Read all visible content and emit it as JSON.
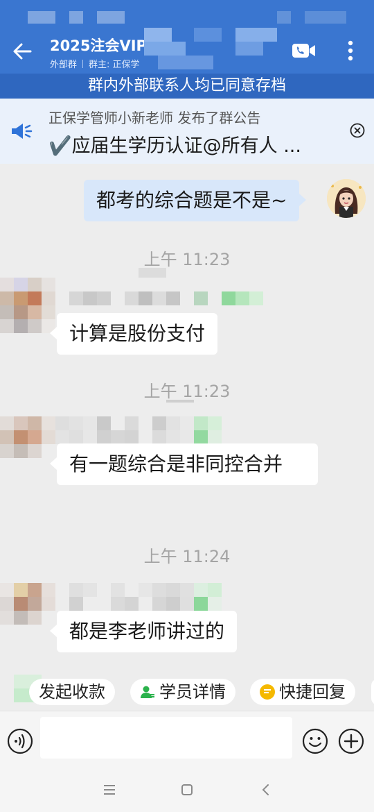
{
  "header": {
    "title": "2025注会VIP",
    "tag": "外部群",
    "owner_prefix": "群主: 正保学",
    "consent_notice": "群内外部联系人均已同意存档",
    "icons": {
      "back": "back-arrow-icon",
      "video": "video-call-icon",
      "more": "more-vertical-icon"
    }
  },
  "announcement": {
    "author_line": "正保学管师小新老师 发布了群公告",
    "text": "✔️应届生学历认证@所有人 ...",
    "icon": "megaphone-icon",
    "close_icon": "close-circle-icon"
  },
  "messages": [
    {
      "sender": "me",
      "text": "都考的综合题是不是~"
    },
    {
      "timestamp": "上午 11:23"
    },
    {
      "sender": "other",
      "text": "计算是股份支付"
    },
    {
      "timestamp": "上午 11:23"
    },
    {
      "sender": "other",
      "text": "有一题综合是非同控合并"
    },
    {
      "timestamp": "上午 11:24"
    },
    {
      "sender": "other",
      "text": "都是李老师讲过的"
    }
  ],
  "quick_actions": [
    {
      "label": "发起收款",
      "icon": "payment-icon"
    },
    {
      "label": "学员详情",
      "icon": "student-profile-icon",
      "color": "#2bb24c"
    },
    {
      "label": "快捷回复",
      "icon": "quick-reply-icon",
      "color": "#f5b900"
    }
  ],
  "input": {
    "value": "",
    "placeholder": "",
    "icons": {
      "voice": "voice-input-icon",
      "emoji": "emoji-icon",
      "plus": "plus-icon"
    }
  },
  "navbar": {
    "icons": [
      "menu-icon",
      "home-square-icon",
      "back-chevron-icon"
    ]
  },
  "colors": {
    "header_blue": "#3a76d0",
    "consent_bar": "#2f67bf",
    "my_bubble": "#d8e7fa",
    "chat_bg": "#ededed"
  }
}
